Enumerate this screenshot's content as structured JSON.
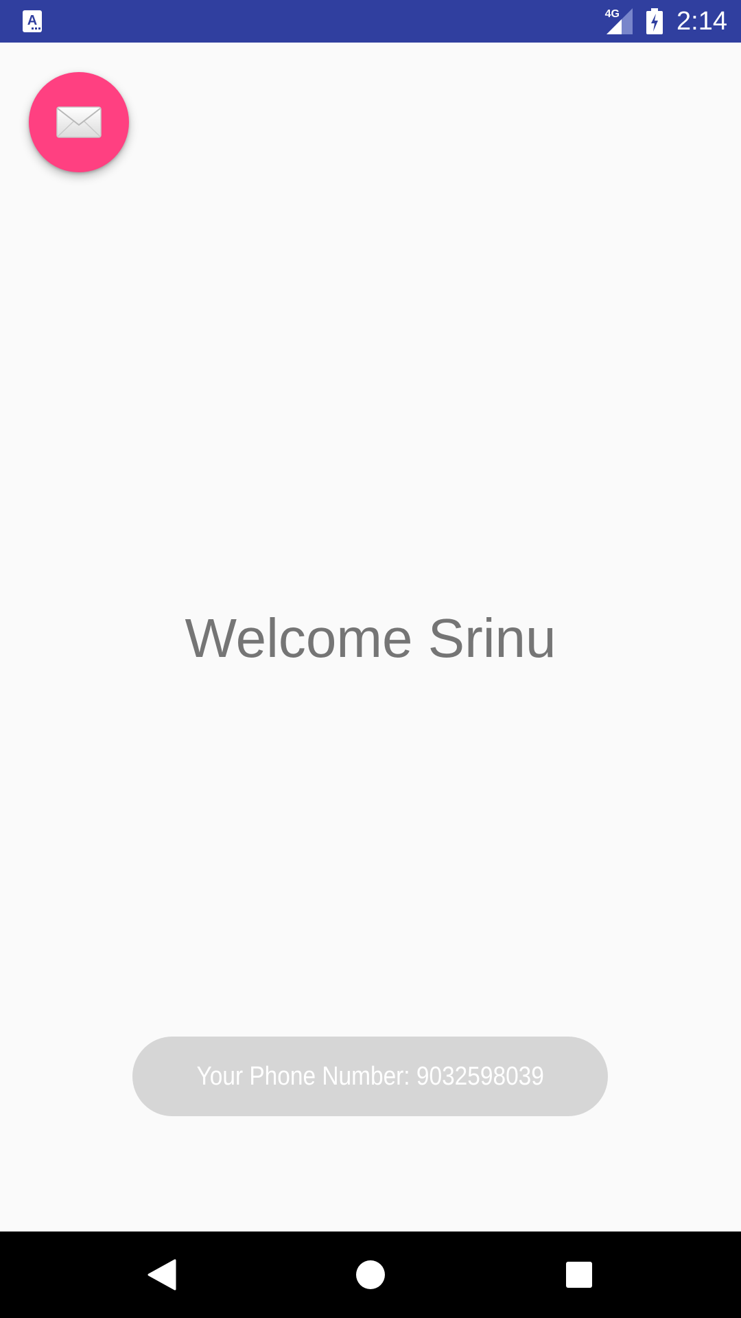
{
  "status_bar": {
    "network_type": "4G",
    "time": "2:14",
    "color": "#303f9f",
    "icons": [
      "app-notification-icon",
      "signal-icon",
      "battery-charging-icon"
    ]
  },
  "fab": {
    "icon": "mail-icon",
    "color": "#ff4081"
  },
  "main": {
    "welcome_text": "Welcome Srinu"
  },
  "toast": {
    "message": "Your Phone Number: 9032598039"
  },
  "nav_bar": {
    "icons": [
      "back-icon",
      "home-icon",
      "recents-icon"
    ]
  }
}
